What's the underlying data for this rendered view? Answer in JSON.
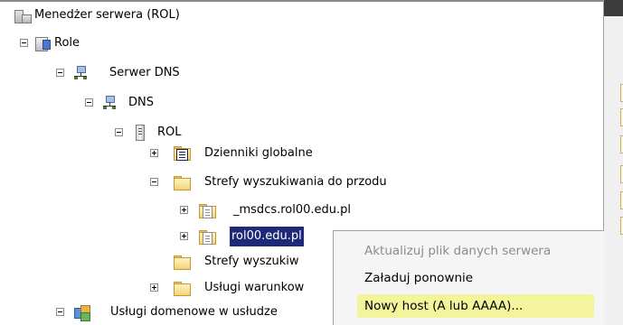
{
  "tree": {
    "items": [
      {
        "label": "Menedżer serwera (ROL)",
        "icon": "server-manager-icon"
      },
      {
        "label": "Role",
        "icon": "roles-icon"
      },
      {
        "label": "Serwer DNS",
        "icon": "dns-server-icon"
      },
      {
        "label": "DNS",
        "icon": "dns-icon"
      },
      {
        "label": "ROL",
        "icon": "server-icon"
      },
      {
        "label": "Dzienniki globalne",
        "icon": "global-logs-icon"
      },
      {
        "label": "Strefy wyszukiwania do przodu",
        "icon": "folder-icon"
      },
      {
        "label": "_msdcs.rol00.edu.pl",
        "icon": "zone-icon"
      },
      {
        "label": "rol00.edu.pl",
        "icon": "zone-icon",
        "selected": true
      },
      {
        "label": "Strefy wyszukiw",
        "icon": "folder-icon"
      },
      {
        "label": "Usługi warunkow",
        "icon": "folder-icon"
      },
      {
        "label": "Usługi domenowe w usłudze",
        "icon": "ad-ds-icon"
      }
    ]
  },
  "context_menu": {
    "items": [
      {
        "label": "Aktualizuj plik danych serwera",
        "enabled": false
      },
      {
        "label": "Załaduj ponownie",
        "enabled": true
      },
      {
        "label": "Nowy host (A lub AAAA)...",
        "enabled": true,
        "highlighted": true
      }
    ],
    "highlight_color": "#f4f49c"
  },
  "colors": {
    "selection": "#1e2a78"
  }
}
